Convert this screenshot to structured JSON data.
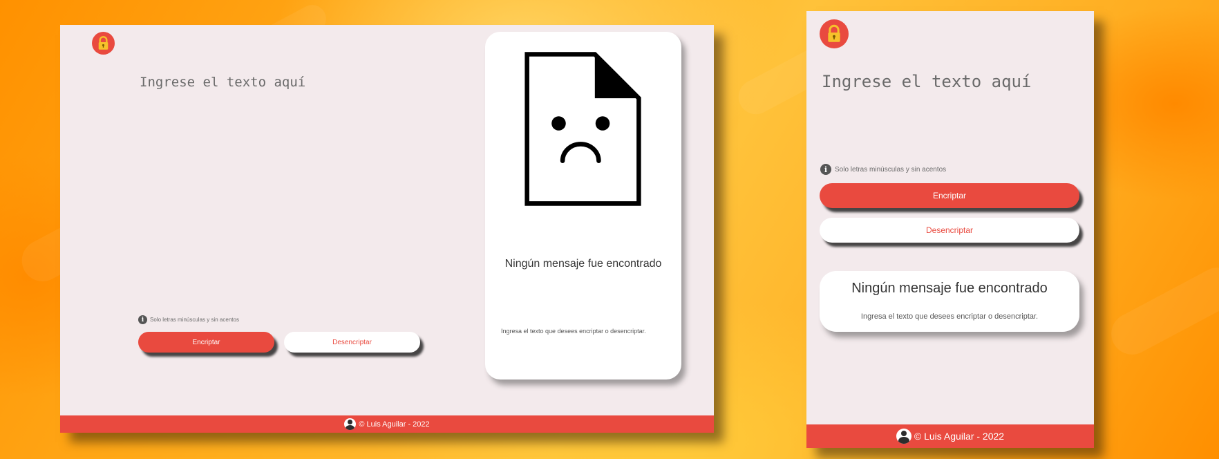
{
  "colors": {
    "accent": "#e94a3f",
    "panel": "#f3eaec",
    "background": "#ffaa1c",
    "card": "#ffffff"
  },
  "desktop": {
    "logo_icon": "lock-icon",
    "input_placeholder": "Ingrese el texto aquí",
    "note_icon": "info-icon",
    "note_text": "Solo letras minúsculas y sin acentos",
    "encrypt_label": "Encriptar",
    "decrypt_label": "Desencriptar",
    "result": {
      "illustration_icon": "sad-document-icon",
      "title": "Ningún mensaje fue encontrado",
      "text": "Ingresa el texto que desees encriptar o desencriptar."
    },
    "footer_text": "© Luis Aguilar - 2022"
  },
  "mobile": {
    "logo_icon": "lock-icon",
    "input_placeholder": "Ingrese el texto aquí",
    "note_icon": "info-icon",
    "note_text": "Solo letras minúsculas y sin acentos",
    "encrypt_label": "Encriptar",
    "decrypt_label": "Desencriptar",
    "result": {
      "title": "Ningún mensaje fue encontrado",
      "text": "Ingresa el texto que desees encriptar o desencriptar."
    },
    "footer_text": "© Luis Aguilar - 2022"
  }
}
